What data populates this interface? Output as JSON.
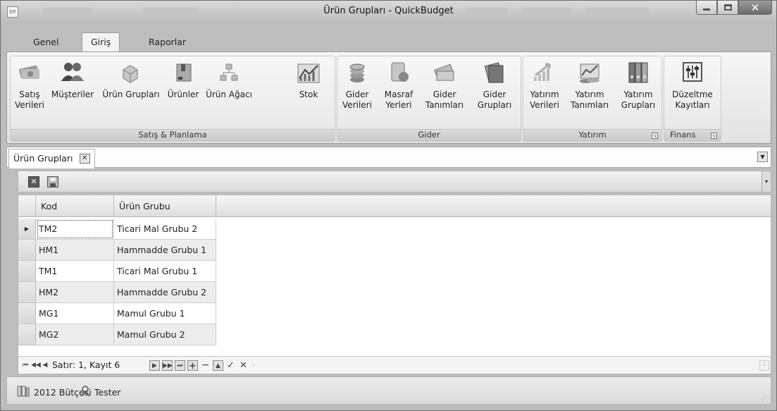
{
  "window": {
    "title": "Ürün Grupları - QuickBudget",
    "app_icon": "ER"
  },
  "ribbon_tabs": [
    "Genel",
    "Giriş",
    "Raporlar"
  ],
  "ribbon": {
    "groups": [
      {
        "label": "Satış & Planlama",
        "buttons": [
          {
            "label": "Satış\nVerileri",
            "icon": "money-icon"
          },
          {
            "label": "Müşteriler",
            "icon": "people-icon"
          },
          {
            "label": "Ürün Grupları",
            "icon": "boxes-icon"
          },
          {
            "label": "Ürünler",
            "icon": "product-icon"
          },
          {
            "label": "Ürün Ağacı",
            "icon": "tree-icon"
          },
          {
            "label": "Stok",
            "icon": "stock-chart-icon"
          }
        ]
      },
      {
        "label": "Gider",
        "buttons": [
          {
            "label": "Gider\nVerileri",
            "icon": "coins-icon"
          },
          {
            "label": "Masraf\nYerleri",
            "icon": "cost-center-icon"
          },
          {
            "label": "Gider\nTanımları",
            "icon": "cash-icon"
          },
          {
            "label": "Gider\nGrupları",
            "icon": "folders-icon"
          }
        ]
      },
      {
        "label": "Yatırım",
        "buttons": [
          {
            "label": "Yatırım\nVerileri",
            "icon": "growth-icon"
          },
          {
            "label": "Yatırım\nTanımları",
            "icon": "investment-icon"
          },
          {
            "label": "Yatırım\nGrupları",
            "icon": "binders-icon"
          }
        ]
      },
      {
        "label": "Finans",
        "buttons": [
          {
            "label": "Düzeltme\nKayıtları",
            "icon": "adjust-icon"
          }
        ]
      }
    ]
  },
  "doc_tab": {
    "label": "Ürün Grupları"
  },
  "grid": {
    "columns": [
      "Kod",
      "Ürün Grubu"
    ],
    "rows": [
      {
        "kod": "TM2",
        "grup": "Ticari Mal Grubu 2"
      },
      {
        "kod": "HM1",
        "grup": "Hammadde Grubu 1"
      },
      {
        "kod": "TM1",
        "grup": "Ticari Mal Grubu 1"
      },
      {
        "kod": "HM2",
        "grup": "Hammadde Grubu 2"
      },
      {
        "kod": "MG1",
        "grup": "Mamul Grubu 1"
      },
      {
        "kod": "MG2",
        "grup": "Mamul Grubu 2"
      }
    ]
  },
  "navigator": {
    "text": "Satır: 1, Kayıt 6"
  },
  "status": {
    "budget": "2012 Bütçesi",
    "user": "Tester"
  }
}
